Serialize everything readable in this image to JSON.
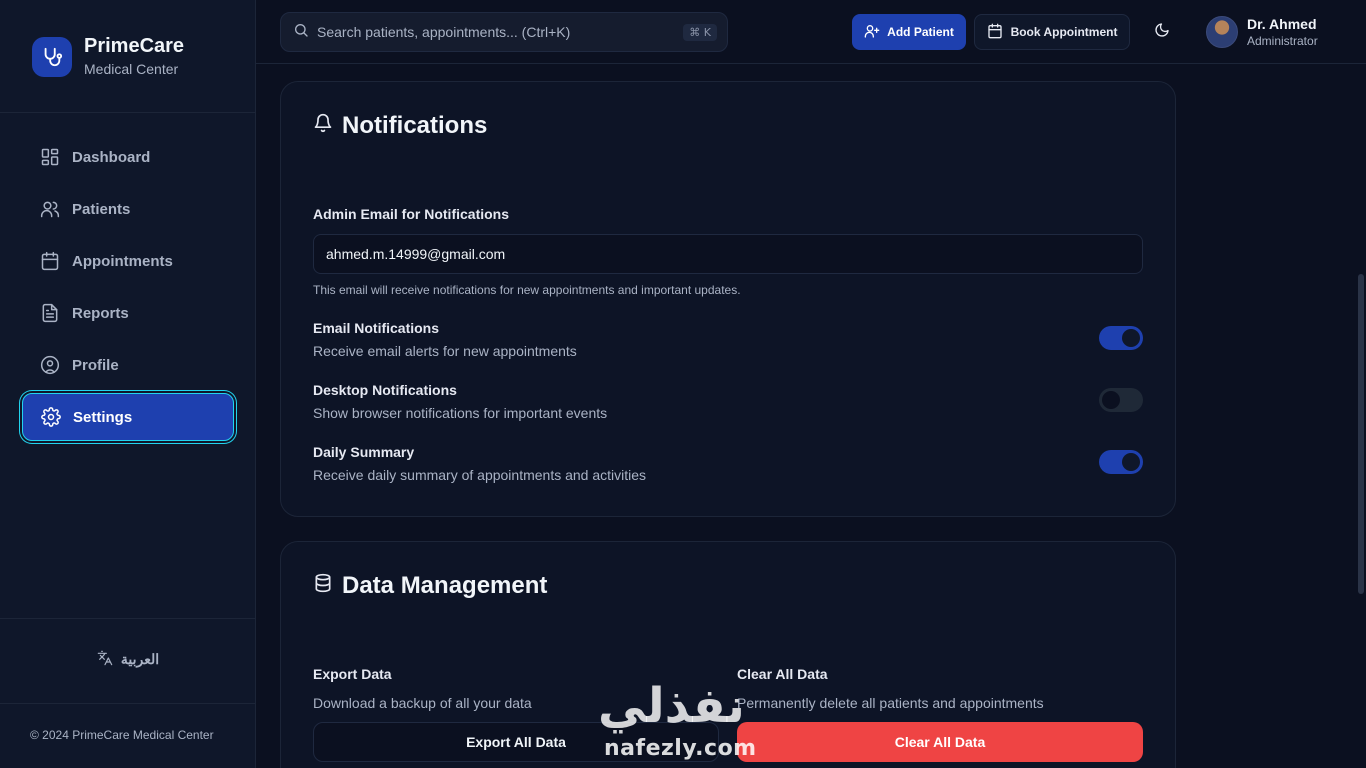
{
  "brand": {
    "name": "PrimeCare",
    "subtitle": "Medical Center"
  },
  "sidebar": {
    "items": [
      {
        "label": "Dashboard",
        "icon": "dashboard-icon"
      },
      {
        "label": "Patients",
        "icon": "users-icon"
      },
      {
        "label": "Appointments",
        "icon": "calendar-icon"
      },
      {
        "label": "Reports",
        "icon": "file-text-icon"
      },
      {
        "label": "Profile",
        "icon": "user-circle-icon"
      },
      {
        "label": "Settings",
        "icon": "gear-icon",
        "active": true
      }
    ],
    "language_label": "العربية",
    "copyright": "© 2024 PrimeCare Medical Center"
  },
  "topbar": {
    "search_placeholder": "Search patients, appointments... (Ctrl+K)",
    "search_shortcut": "⌘ K",
    "add_patient_label": "Add Patient",
    "book_appointment_label": "Book Appointment",
    "user": {
      "name": "Dr. Ahmed",
      "role": "Administrator"
    }
  },
  "notifications": {
    "title": "Notifications",
    "email_label": "Admin Email for Notifications",
    "email_value": "ahmed.m.14999@gmail.com",
    "email_help": "This email will receive notifications for new appointments and important updates.",
    "toggles": [
      {
        "title": "Email Notifications",
        "description": "Receive email alerts for new appointments",
        "enabled": true
      },
      {
        "title": "Desktop Notifications",
        "description": "Show browser notifications for important events",
        "enabled": false
      },
      {
        "title": "Daily Summary",
        "description": "Receive daily summary of appointments and activities",
        "enabled": true
      }
    ]
  },
  "data_management": {
    "title": "Data Management",
    "export": {
      "title": "Export Data",
      "description": "Download a backup of all your data",
      "button": "Export All Data"
    },
    "clear": {
      "title": "Clear All Data",
      "description": "Permanently delete all patients and appointments",
      "button": "Clear All Data"
    }
  },
  "watermark": {
    "arabic": "نفذلي",
    "latin": "nafezly.com"
  },
  "colors": {
    "accent": "#1e40af",
    "focus_ring": "#22d3ee",
    "danger": "#ef4444",
    "background": "#0b1020"
  }
}
